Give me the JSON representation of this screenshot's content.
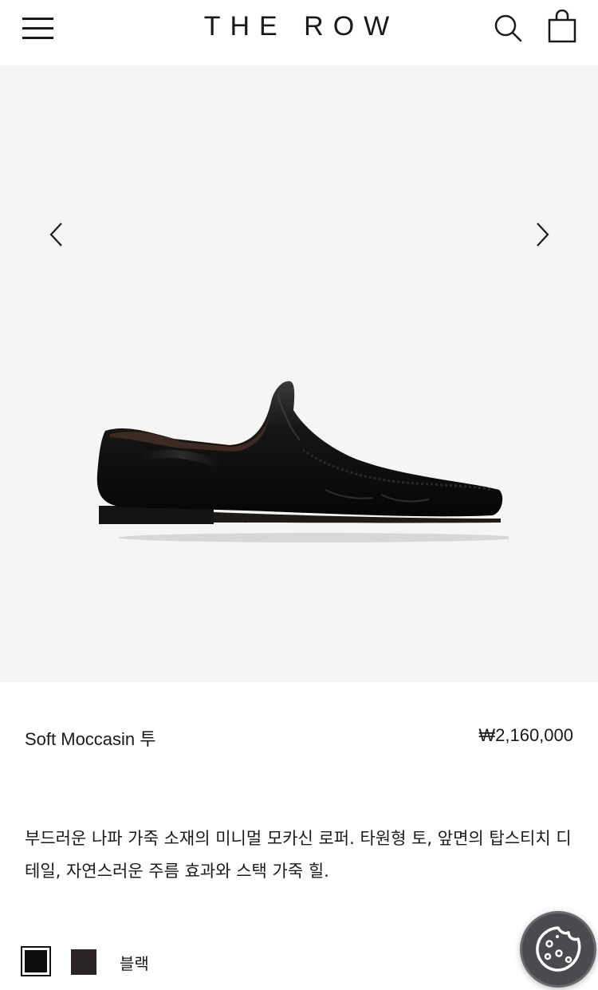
{
  "header": {
    "logo": "THE ROW",
    "menu_icon": "hamburger-menu-icon",
    "search_icon": "search-icon",
    "bag_icon": "shopping-bag-icon"
  },
  "gallery": {
    "prev_icon": "chevron-left-icon",
    "next_icon": "chevron-right-icon",
    "background_color": "#f5f5f3"
  },
  "product": {
    "name": "Soft Moccasin 투",
    "price": "₩2,160,000",
    "description": "부드러운 나파 가죽 소재의 미니멀 모카신 로퍼. 타원형 토, 앞면의 탑스티치 디테일, 자연스러운 주름 효과와 스택 가죽 힐.",
    "colors": [
      {
        "hex": "#0d0d0d",
        "selected": true
      },
      {
        "hex": "#2b2625",
        "selected": false
      }
    ],
    "selected_color_label": "블랙"
  },
  "cookie_button": {
    "icon": "cookie-icon",
    "color": "#4b4b4f"
  }
}
